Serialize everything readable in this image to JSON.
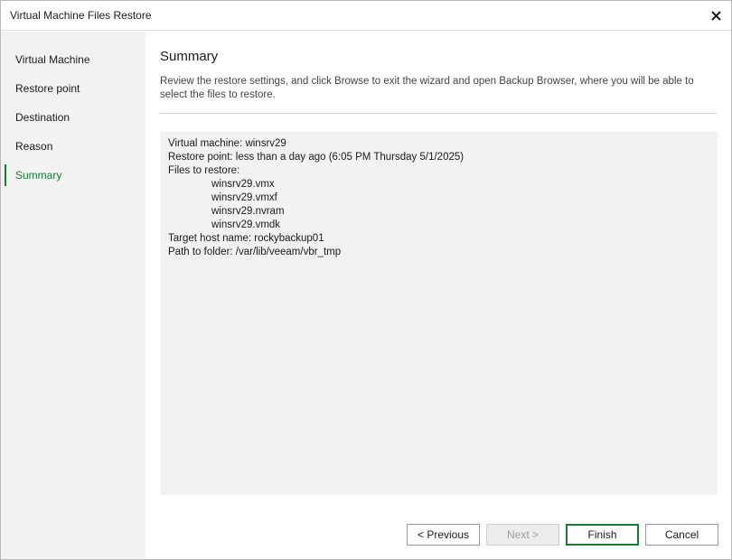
{
  "window": {
    "title": "Virtual Machine Files Restore"
  },
  "sidebar": {
    "items": [
      {
        "label": "Virtual Machine",
        "active": false
      },
      {
        "label": "Restore point",
        "active": false
      },
      {
        "label": "Destination",
        "active": false
      },
      {
        "label": "Reason",
        "active": false
      },
      {
        "label": "Summary",
        "active": true
      }
    ]
  },
  "main": {
    "title": "Summary",
    "description": "Review the restore settings, and click Browse to exit the wizard and open Backup Browser, where you will be able to select the files to restore.",
    "summary": {
      "vm_line": "Virtual machine: winsrv29",
      "restore_point_line": "Restore point: less than a day ago (6:05 PM Thursday 5/1/2025)",
      "files_header": "Files to restore:",
      "files": [
        "winsrv29.vmx",
        "winsrv29.vmxf",
        "winsrv29.nvram",
        "winsrv29.vmdk"
      ],
      "target_host_line": "Target host name: rockybackup01",
      "path_line": "Path to folder: /var/lib/veeam/vbr_tmp"
    }
  },
  "buttons": {
    "previous": "< Previous",
    "next": "Next >",
    "finish": "Finish",
    "cancel": "Cancel"
  },
  "colors": {
    "accent": "#1b7a3a",
    "sidebar_bg": "#f1f2f1",
    "summary_bg": "#f1f2f1"
  },
  "icons": {
    "close": "close-icon"
  }
}
